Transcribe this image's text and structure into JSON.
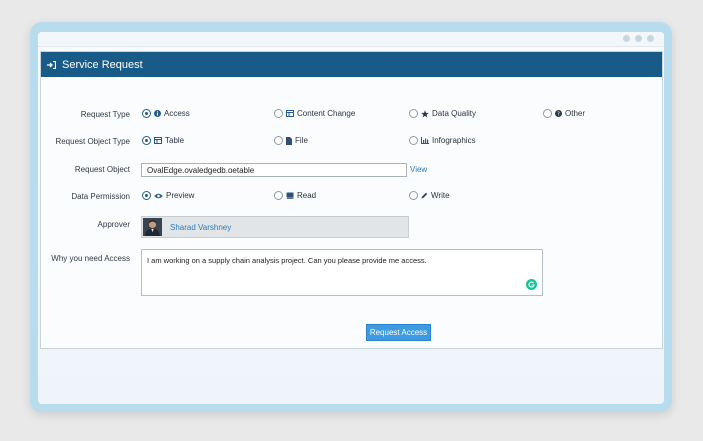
{
  "panel": {
    "title": "Service Request"
  },
  "form": {
    "request_type": {
      "label": "Request Type",
      "options": [
        "Access",
        "Content Change",
        "Data Quality",
        "Other"
      ],
      "selected": "Access"
    },
    "request_object_type": {
      "label": "Request Object Type",
      "options": [
        "Table",
        "File",
        "Infographics"
      ],
      "selected": "Table"
    },
    "request_object": {
      "label": "Request Object",
      "value": "OvalEdge.ovaledgedb.oetable",
      "link": "View"
    },
    "data_permission": {
      "label": "Data Permission",
      "options": [
        "Preview",
        "Read",
        "Write"
      ],
      "selected": "Preview"
    },
    "approver": {
      "label": "Approver",
      "name": "Sharad Varshney"
    },
    "reason": {
      "label": "Why you need Access",
      "value": "I am working on a supply chain analysis project. Can you please provide me access."
    },
    "submit_label": "Request Access"
  },
  "colors": {
    "header": "#195b88",
    "button": "#3c9be3",
    "link": "#2b7bbd",
    "frame": "#b6dcee"
  },
  "icons": [
    "sign-in-icon",
    "info-icon",
    "table-icon",
    "star-icon",
    "question-icon",
    "file-icon",
    "bar-chart-icon",
    "eye-icon",
    "book-icon",
    "pencil-icon",
    "grammarly-icon"
  ]
}
